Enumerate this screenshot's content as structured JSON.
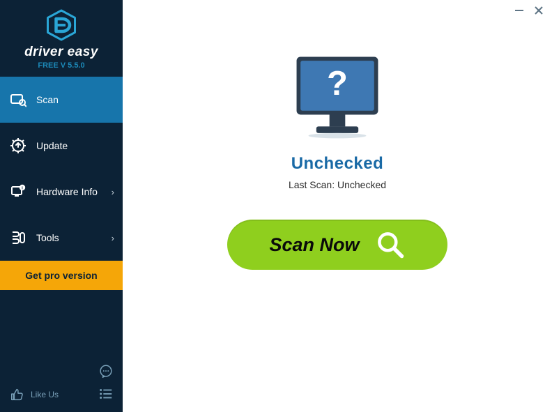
{
  "brand": {
    "title": "driver easy",
    "subtitle": "FREE V 5.5.0"
  },
  "sidebar": {
    "items": [
      {
        "label": "Scan"
      },
      {
        "label": "Update"
      },
      {
        "label": "Hardware Info"
      },
      {
        "label": "Tools"
      }
    ],
    "pro_label": "Get pro version",
    "like_label": "Like Us"
  },
  "main": {
    "status_title": "Unchecked",
    "status_sub": "Last Scan: Unchecked",
    "scan_button_label": "Scan Now"
  }
}
